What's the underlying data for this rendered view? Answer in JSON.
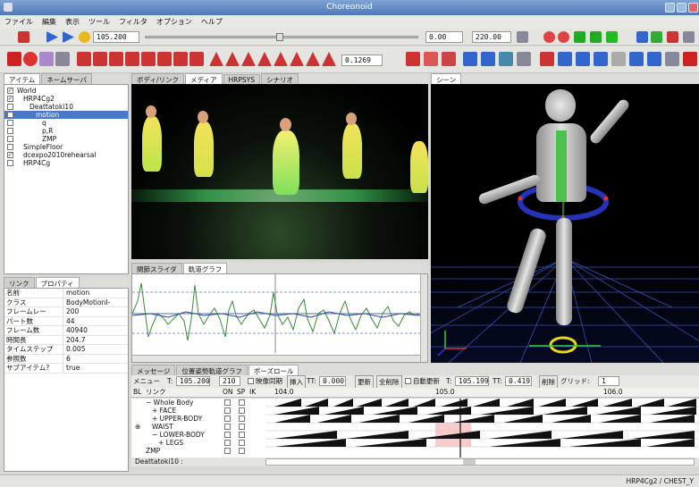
{
  "window": {
    "title": "Choreonoid"
  },
  "menu": [
    "ファイル",
    "編集",
    "表示",
    "ツール",
    "フィルタ",
    "オプション",
    "ヘルプ"
  ],
  "toolbar1": {
    "time": "105.200",
    "range_start": "0.00",
    "range_end": "220.00"
  },
  "toolbar2": {
    "value": "0.1269"
  },
  "item_tabs": [
    "アイテム",
    "ネームサーバ"
  ],
  "item_tree": [
    {
      "label": "World",
      "indent": 0,
      "checked": true
    },
    {
      "label": "HRP4Cg2",
      "indent": 1,
      "checked": true
    },
    {
      "label": "Deattatoki10",
      "indent": 2,
      "checked": false
    },
    {
      "label": "motion",
      "indent": 3,
      "checked": false,
      "selected": true
    },
    {
      "label": "q",
      "indent": 4,
      "checked": false
    },
    {
      "label": "p,R",
      "indent": 4,
      "checked": false
    },
    {
      "label": "ZMP",
      "indent": 4,
      "checked": false
    },
    {
      "label": "SimpleFloor",
      "indent": 1,
      "checked": false
    },
    {
      "label": "dcexpo2010rehearsal",
      "indent": 1,
      "checked": true
    },
    {
      "label": "HRP4Cg",
      "indent": 1,
      "checked": false
    }
  ],
  "prop_tabs": [
    "リンク",
    "プロパティ"
  ],
  "properties": [
    [
      "名前",
      "motion"
    ],
    [
      "クラス",
      "BodyMotionI-"
    ],
    [
      "フレームレー",
      "200"
    ],
    [
      "パート数",
      "44"
    ],
    [
      "フレーム数",
      "40940"
    ],
    [
      "時間長",
      "204.7"
    ],
    [
      "タイムステップ",
      "0.005"
    ],
    [
      "参照数",
      "6"
    ],
    [
      "サブアイテム?",
      "true"
    ]
  ],
  "view_tabs": [
    "ボディ/リンク",
    "メディア",
    "HRPSYS",
    "シナリオ"
  ],
  "scene_tab": "シーン",
  "graph_tabs": [
    "関節スライダ",
    "軌道グラフ"
  ],
  "bottom_tabs": [
    "メッセージ",
    "位置姿勢軌道グラフ",
    "ポーズロール"
  ],
  "pose_toolbar": {
    "menu": "メニュー",
    "t_label": "T:",
    "t_value": "105.200",
    "frame": "210",
    "sync_label": "映像同期",
    "insert_label": "挿入",
    "tt_label": "TT:",
    "tt_value": "0.000",
    "update_label": "更新",
    "pre_label": "全削除",
    "auto_label": "自動更新",
    "t2_label": "T:",
    "t2_value": "105.199",
    "tt2_label": "TT:",
    "tt2_value": "0.419",
    "delete_label": "削除",
    "grid_label": "グリッド:",
    "grid_value": "1"
  },
  "pose_header": {
    "col1": "BL",
    "col2": "リンク",
    "on": "ON",
    "sp": "SP",
    "ik": "IK",
    "t1": "104.0",
    "t2": "105.0",
    "t3": "106.0"
  },
  "pose_rows": [
    {
      "label": "− Whole Body",
      "indent": 0
    },
    {
      "label": "+ FACE",
      "indent": 1
    },
    {
      "label": "+ UPPER-BODY",
      "indent": 1
    },
    {
      "label": "WAIST",
      "indent": 1,
      "bl": "⊕"
    },
    {
      "label": "− LOWER-BODY",
      "indent": 1
    },
    {
      "label": "+ LEGS",
      "indent": 2
    },
    {
      "label": "ZMP",
      "indent": 0
    }
  ],
  "pose_footer": "Deattatoki10 :",
  "status": "HRP4Cg2 / CHEST_Y"
}
